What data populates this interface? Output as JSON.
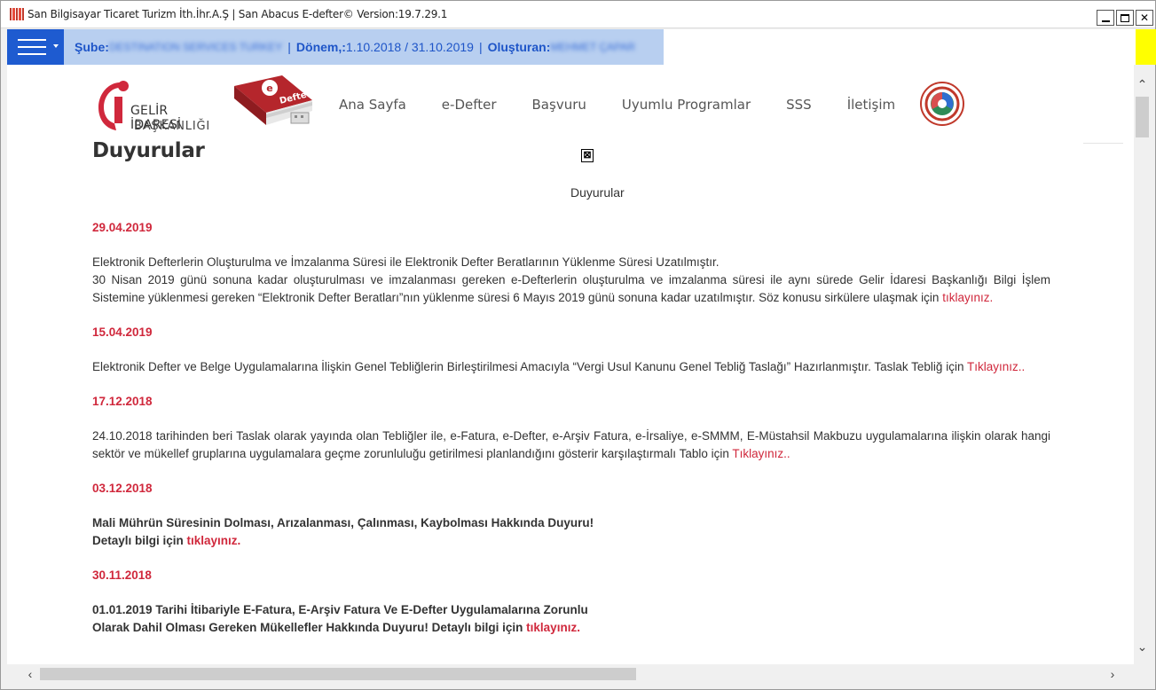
{
  "window": {
    "title": "San Bilgisayar Ticaret Turizm İth.İhr.A.Ş | San Abacus E-defter© Version:19.7.29.1",
    "min_label": "_",
    "max_label": "□",
    "close_label": "✕"
  },
  "header": {
    "sube_label": "Şube:",
    "sube_value": "DESTINATION SERVICES TURKEY",
    "separator": "|",
    "donem_label": "Dönem,:",
    "donem_value": "1.10.2018 / 31.10.2019",
    "olusturan_label": "Oluşturan:",
    "olusturan_value": "MEHMET ÇAPAR",
    "yellow_color": "#ffff00",
    "menu_color": "#1e5bd0"
  },
  "site": {
    "logo_line1": "GELİR İDARESİ",
    "logo_line2": "BAŞKANLIĞI",
    "book_logo_text": "Defter",
    "nav": [
      "Ana Sayfa",
      "e-Defter",
      "Başvuru",
      "Uyumlu Programlar",
      "SSS",
      "İletişim"
    ],
    "page_heading": "Duyurular",
    "broken_image_glyph": "⊠",
    "sub_heading": "Duyurular"
  },
  "announcements": [
    {
      "date": "29.04.2019",
      "line1": "Elektronik Defterlerin Oluşturulma ve İmzalanma Süresi ile Elektronik Defter Beratlarının Yüklenme Süresi Uzatılmıştır.",
      "line2": "30 Nisan 2019 günü sonuna kadar oluşturulması ve imzalanması gereken e-Defterlerin oluşturulma ve imzalanma süresi ile aynı sürede Gelir İdaresi Başkanlığı Bilgi İşlem Sistemine yüklenmesi gereken “Elektronik Defter Beratları”nın yüklenme süresi 6 Mayıs 2019 günü sonuna kadar uzatılmıştır. Söz konusu sirkülere ulaşmak için ",
      "link": "tıklayınız."
    },
    {
      "date": "15.04.2019",
      "text": "Elektronik Defter ve Belge Uygulamalarına İlişkin Genel Tebliğlerin Birleştirilmesi Amacıyla “Vergi Usul Kanunu Genel Tebliğ Taslağı” Hazırlanmıştır. Taslak Tebliğ için ",
      "link": "Tıklayınız.."
    },
    {
      "date": "17.12.2018",
      "text": "24.10.2018 tarihinden beri Taslak olarak yayında olan Tebliğler ile, e-Fatura, e-Defter, e-Arşiv Fatura, e-İrsaliye, e-SMMM, E-Müstahsil Makbuzu uygulamalarına ilişkin olarak hangi sektör ve mükellef gruplarına uygulamalara geçme zorunluluğu getirilmesi planlandığını gösterir karşılaştırmalı Tablo için ",
      "link": "Tıklayınız.."
    },
    {
      "date": "03.12.2018",
      "line1": "Mali Mührün Süresinin Dolması, Arızalanması, Çalınması, Kaybolması Hakkında Duyuru!",
      "line2": "Detaylı bilgi için ",
      "link": "tıklayınız."
    },
    {
      "date": "30.11.2018",
      "line1": "01.01.2019 Tarihi İtibariyle E-Fatura, E-Arşiv Fatura Ve E-Defter Uygulamalarına Zorunlu",
      "line2": "Olarak Dahil Olması Gereken Mükellefler Hakkında Duyuru! Detaylı bilgi için ",
      "link": "tıklayınız."
    }
  ],
  "scroll": {
    "up": "⌃",
    "down": "⌄",
    "left": "‹",
    "right": "›"
  },
  "colors": {
    "accent_red": "#d0283c",
    "info_bar": "#b8cff0",
    "info_text": "#1e55c8"
  }
}
